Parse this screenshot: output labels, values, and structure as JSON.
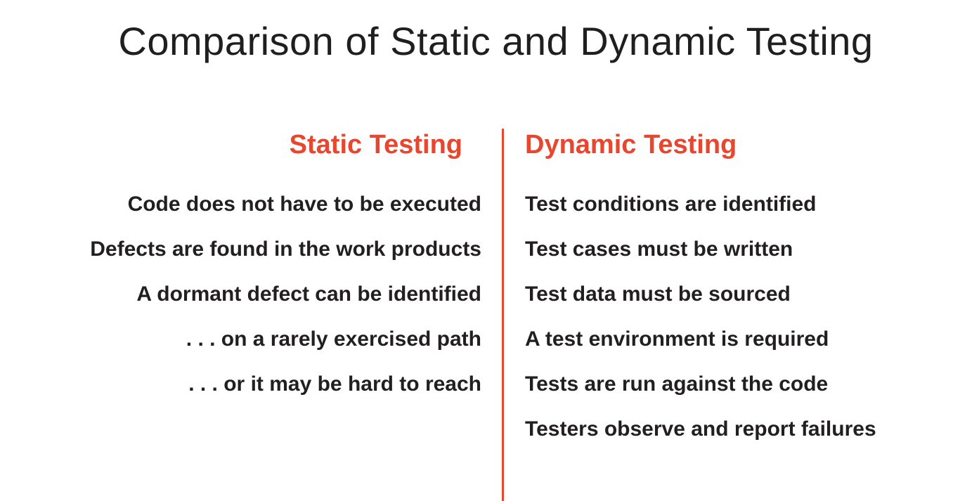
{
  "slide": {
    "title": "Comparison of Static and Dynamic Testing"
  },
  "left": {
    "heading": "Static Testing",
    "items": [
      "Code does not have to be executed",
      "Defects are found in the work products",
      "A dormant defect can be identified",
      ". . .  on a rarely exercised path",
      ". . .  or it may be hard to reach"
    ]
  },
  "right": {
    "heading": "Dynamic Testing",
    "items": [
      "Test conditions are identified",
      "Test cases must be written",
      "Test data must be sourced",
      "A test environment is required",
      "Tests are run against the code",
      "Testers observe and report failures"
    ]
  },
  "colors": {
    "accent": "#e8472f",
    "text": "#231f20"
  }
}
